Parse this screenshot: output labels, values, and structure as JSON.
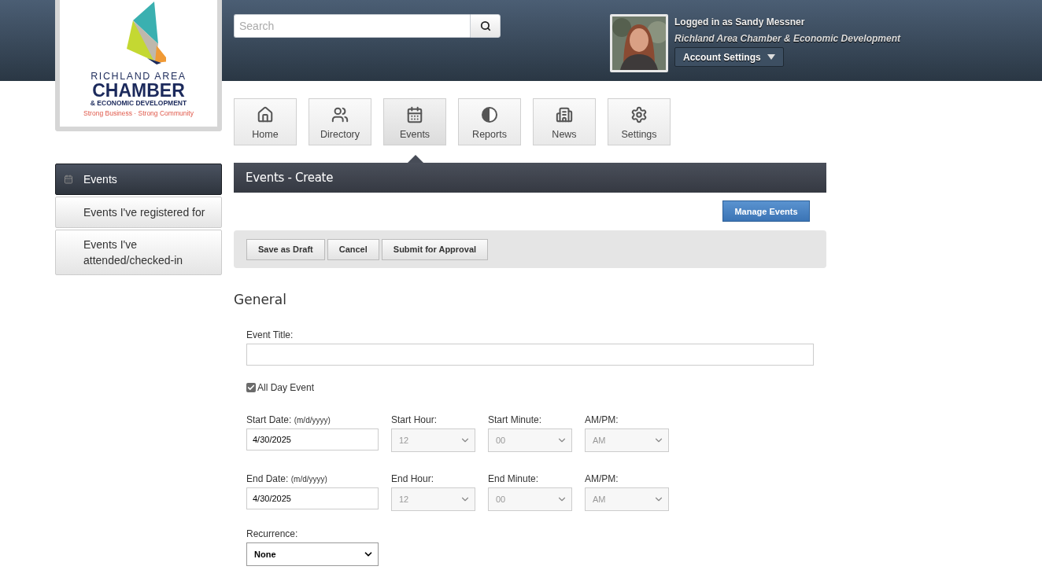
{
  "logo": {
    "line_1": "RICHLAND AREA",
    "line_2": "CHAMBER",
    "line_3": "& ECONOMIC DEVELOPMENT",
    "tagline": "Strong Business · Strong Community"
  },
  "search": {
    "placeholder": "Search"
  },
  "user": {
    "logged_in": "Logged in as Sandy Messner",
    "organization": "Richland Area Chamber & Economic Development",
    "account_button": "Account Settings"
  },
  "nav_tabs": [
    {
      "label": "Home",
      "selected": false
    },
    {
      "label": "Directory",
      "selected": false
    },
    {
      "label": "Events",
      "selected": true
    },
    {
      "label": "Reports",
      "selected": false
    },
    {
      "label": "News",
      "selected": false
    },
    {
      "label": "Settings",
      "selected": false
    }
  ],
  "sidebar": {
    "items": [
      {
        "label": "Events",
        "selected": true
      },
      {
        "label": "Events I've registered for",
        "selected": false
      },
      {
        "label": "Events I've attended/checked-in",
        "selected": false
      }
    ]
  },
  "page_title": "Events - Create",
  "manage_button": "Manage Events",
  "actions": [
    "Save as Draft",
    "Cancel",
    "Submit for Approval"
  ],
  "section_title": "General",
  "event_title": {
    "label": "Event Title:"
  },
  "all_day": {
    "label": "All Day Event",
    "checked": true
  },
  "date_rows": [
    {
      "fields": [
        {
          "kind": "date",
          "label": "Start Date:",
          "hint": "(m/d/yyyy)",
          "value": "4/30/2025"
        },
        {
          "kind": "select",
          "label": "Start Hour:",
          "value": "12",
          "disabled": true
        },
        {
          "kind": "select",
          "label": "Start Minute:",
          "value": "00",
          "disabled": true
        },
        {
          "kind": "select",
          "label": "AM/PM:",
          "value": "AM",
          "disabled": true
        }
      ]
    },
    {
      "fields": [
        {
          "kind": "date",
          "label": "End Date:",
          "hint": "(m/d/yyyy)",
          "value": "4/30/2025"
        },
        {
          "kind": "select",
          "label": "End Hour:",
          "value": "12",
          "disabled": true
        },
        {
          "kind": "select",
          "label": "End Minute:",
          "value": "00",
          "disabled": true
        },
        {
          "kind": "select",
          "label": "AM/PM:",
          "value": "AM",
          "disabled": true
        }
      ]
    }
  ],
  "recurrence": {
    "label": "Recurrence:",
    "value": "None",
    "disabled": false
  }
}
